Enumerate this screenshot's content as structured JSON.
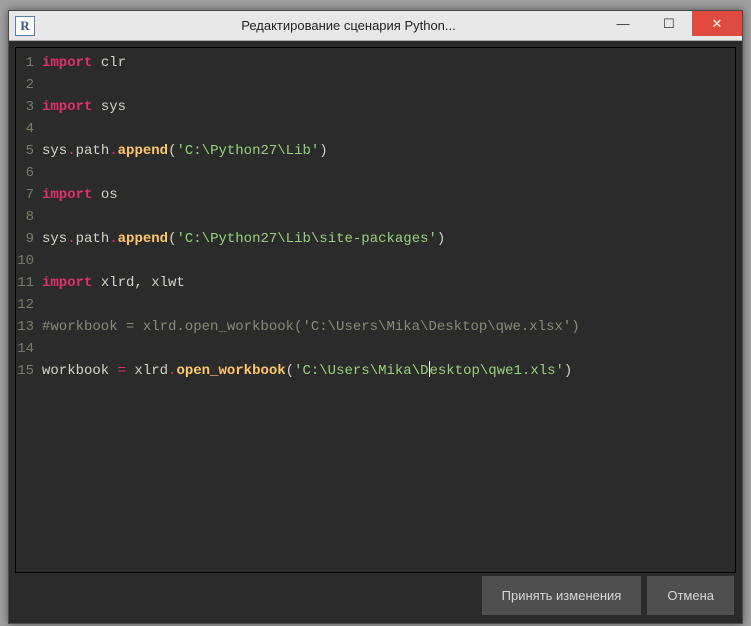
{
  "window": {
    "app_icon_letter": "R",
    "title": "Редактирование сценария Python..."
  },
  "code": {
    "lines": [
      {
        "n": 1,
        "tokens": [
          [
            "kw",
            "import"
          ],
          [
            "",
            " clr"
          ]
        ]
      },
      {
        "n": 2,
        "tokens": []
      },
      {
        "n": 3,
        "tokens": [
          [
            "kw",
            "import"
          ],
          [
            "",
            " sys"
          ]
        ]
      },
      {
        "n": 4,
        "tokens": []
      },
      {
        "n": 5,
        "tokens": [
          [
            "",
            "sys"
          ],
          [
            "jq",
            "."
          ],
          [
            "",
            "path"
          ],
          [
            "jq",
            "."
          ],
          [
            "fn",
            "append"
          ],
          [
            "",
            "("
          ],
          [
            "str",
            "'C:\\Python27\\Lib'"
          ],
          [
            "",
            ")"
          ]
        ]
      },
      {
        "n": 6,
        "tokens": []
      },
      {
        "n": 7,
        "tokens": [
          [
            "kw",
            "import"
          ],
          [
            "",
            " os"
          ]
        ]
      },
      {
        "n": 8,
        "tokens": []
      },
      {
        "n": 9,
        "tokens": [
          [
            "",
            "sys"
          ],
          [
            "jq",
            "."
          ],
          [
            "",
            "path"
          ],
          [
            "jq",
            "."
          ],
          [
            "fn",
            "append"
          ],
          [
            "",
            "("
          ],
          [
            "str",
            "'C:\\Python27\\Lib\\site-packages'"
          ],
          [
            "",
            ")"
          ]
        ]
      },
      {
        "n": 10,
        "tokens": []
      },
      {
        "n": 11,
        "tokens": [
          [
            "kw",
            "import"
          ],
          [
            "",
            " xlrd, xlwt"
          ]
        ]
      },
      {
        "n": 12,
        "tokens": []
      },
      {
        "n": 13,
        "tokens": [
          [
            "cmt",
            "#workbook = xlrd.open_workbook('C:\\Users\\Mika\\Desktop\\qwe.xlsx')"
          ]
        ]
      },
      {
        "n": 14,
        "tokens": []
      },
      {
        "n": 15,
        "tokens": [
          [
            "",
            "workbook "
          ],
          [
            "jq",
            "="
          ],
          [
            "",
            " xlrd"
          ],
          [
            "jq",
            "."
          ],
          [
            "fn",
            "open_workbook"
          ],
          [
            "",
            "("
          ],
          [
            "str",
            "'C:\\Users\\Mika\\D"
          ],
          [
            "cursor",
            ""
          ],
          [
            "str",
            "esktop\\qwe1.xls'"
          ],
          [
            "",
            ")"
          ]
        ]
      }
    ]
  },
  "buttons": {
    "accept": "Принять изменения",
    "cancel": "Отмена"
  },
  "win_controls": {
    "minimize": "—",
    "maximize": "☐",
    "close": "✕"
  }
}
